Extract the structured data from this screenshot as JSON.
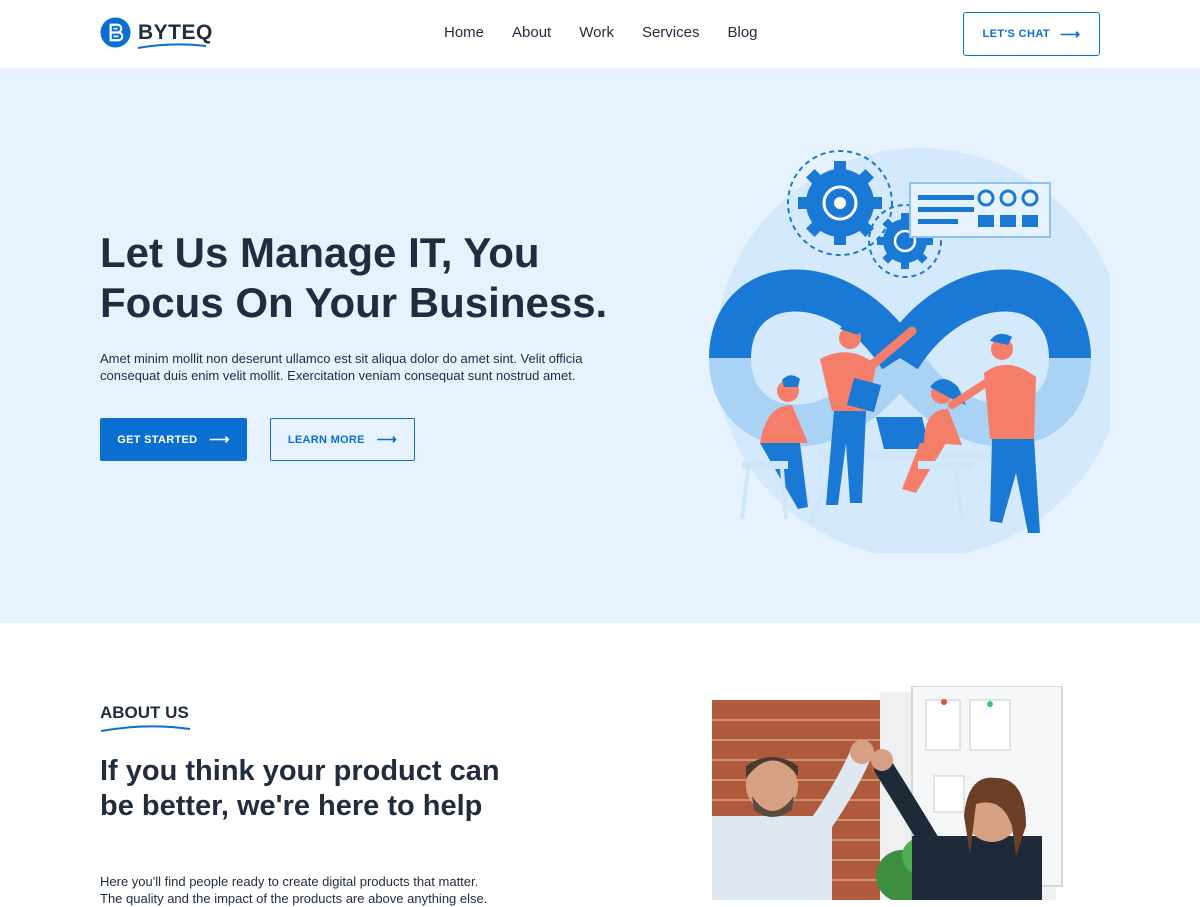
{
  "brand": {
    "name": "BYTEQ",
    "accent_color": "#0a6fd0",
    "hero_bg": "#e6f3fe"
  },
  "nav": {
    "items": [
      "Home",
      "About",
      "Work",
      "Services",
      "Blog"
    ],
    "cta_label": "LET'S CHAT"
  },
  "hero": {
    "title": "Let Us Manage IT, You Focus On Your Business.",
    "text": "Amet minim mollit non deserunt ullamco est sit aliqua dolor do amet sint. Velit officia consequat duis enim velit mollit. Exercitation veniam consequat sunt nostrud amet.",
    "primary_button": "GET STARTED",
    "secondary_button": "LEARN MORE"
  },
  "about": {
    "label": "ABOUT US",
    "title": "If you think your product can be better, we're here to help",
    "text": "Here you'll find people ready to create digital products that matter. The quality and the impact of the products are above anything else."
  },
  "icons": {
    "arrow": "arrow-right-icon",
    "logo": "byteq-logo-icon"
  }
}
